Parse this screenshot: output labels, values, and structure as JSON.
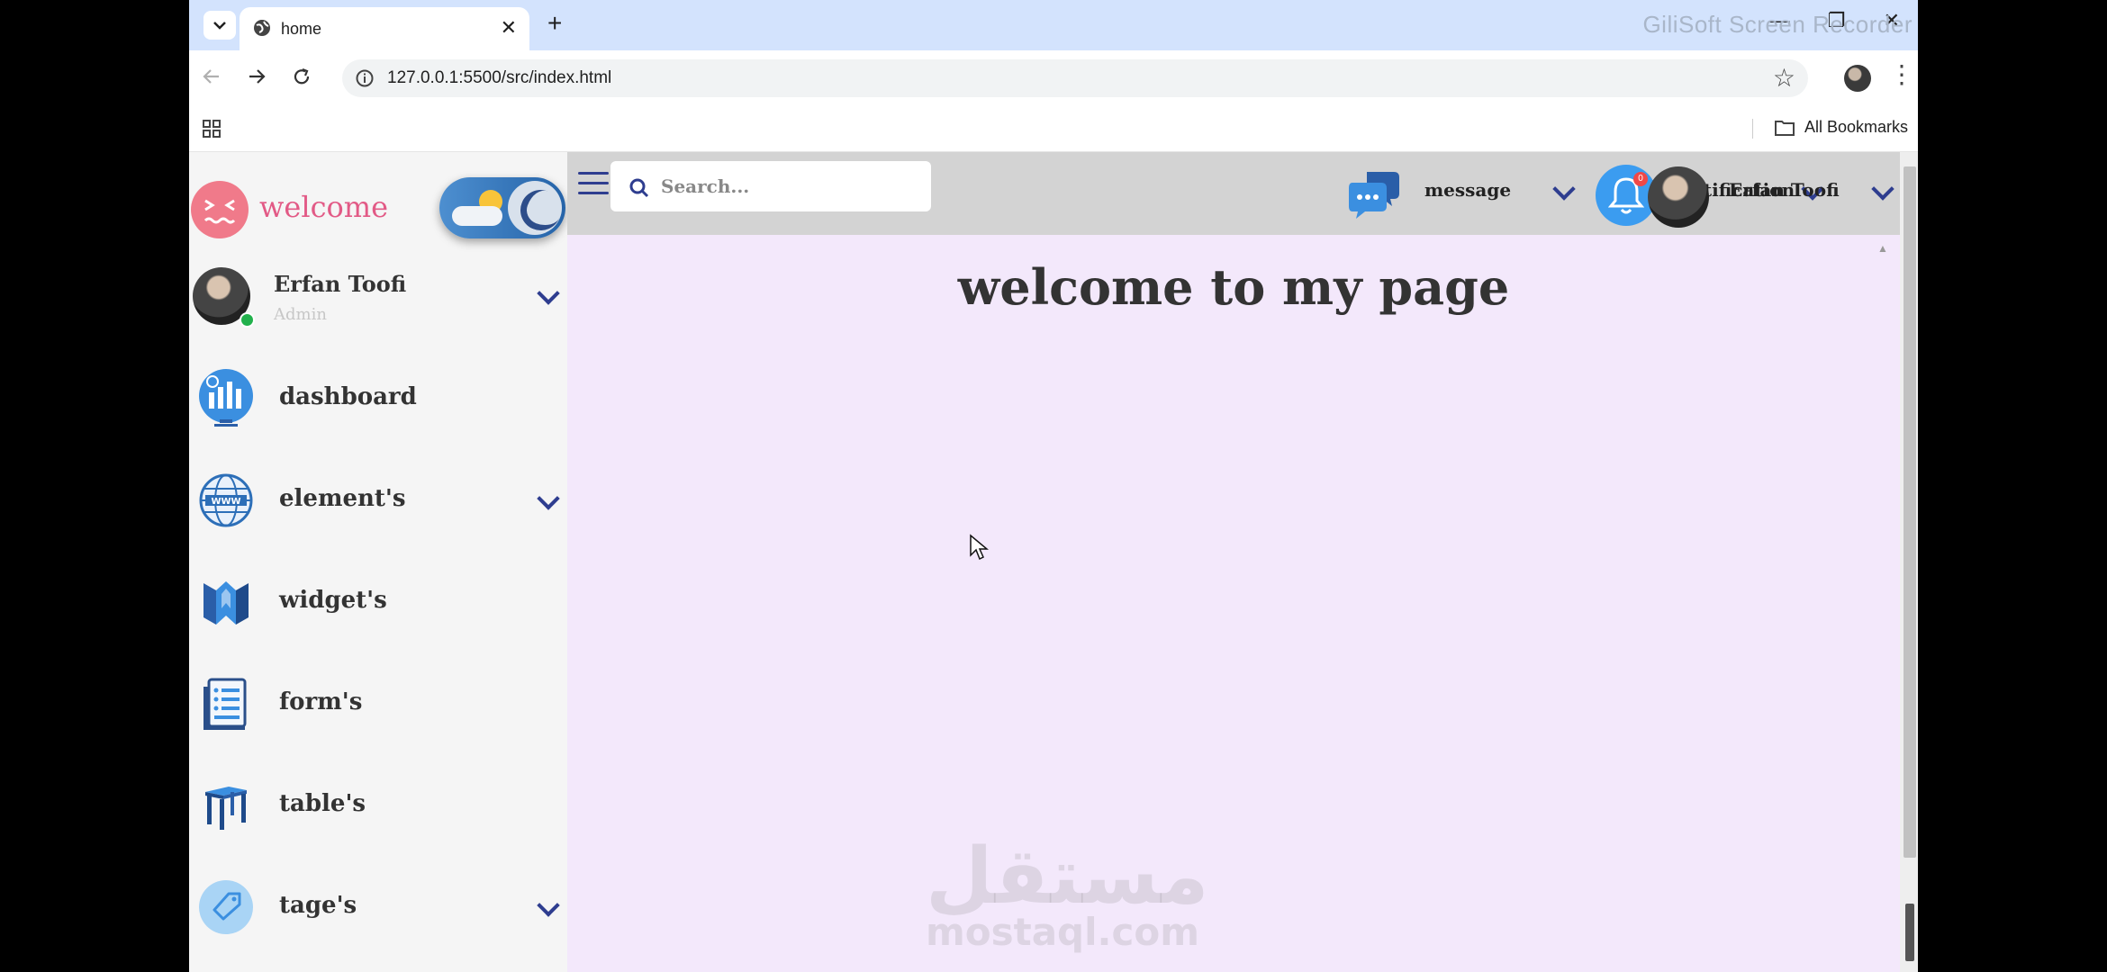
{
  "browser": {
    "tab_title": "home",
    "url": "127.0.0.1:5500/src/index.html",
    "bookmarks_label": "All Bookmarks",
    "recorder_overlay": "GiliSoft Screen Recorder",
    "new_tab_symbol": "+",
    "close_tab_symbol": "✕",
    "window_controls": [
      "—",
      "❐",
      "✕"
    ]
  },
  "sidebar": {
    "welcome": "welcome",
    "user": {
      "name": "Erfan Toofi",
      "role": "Admin"
    },
    "items": [
      {
        "label": "dashboard",
        "icon": "dashboard-icon",
        "has_submenu": false
      },
      {
        "label": "element's",
        "icon": "globe-www-icon",
        "has_submenu": true
      },
      {
        "label": "widget's",
        "icon": "widget-icon",
        "has_submenu": false
      },
      {
        "label": "form's",
        "icon": "form-icon",
        "has_submenu": false
      },
      {
        "label": "table's",
        "icon": "table-icon",
        "has_submenu": false
      },
      {
        "label": "tage's",
        "icon": "tag-icon",
        "has_submenu": true
      }
    ]
  },
  "topbar": {
    "search_placeholder": "Search...",
    "message_label": "message",
    "notification_label": "notification",
    "notification_count": "0",
    "user_name": "Erfan Toofi"
  },
  "main": {
    "heading": "welcome to my page"
  },
  "watermark": {
    "arabic": "مستقل",
    "latin": "mostaql.com"
  },
  "colors": {
    "accent": "#2e3d8f",
    "page_bg": "#f3e8fb",
    "welcome": "#e25a86",
    "sidebar_bg": "#f5f5f5",
    "topbar_bg": "#d3d3d3"
  }
}
